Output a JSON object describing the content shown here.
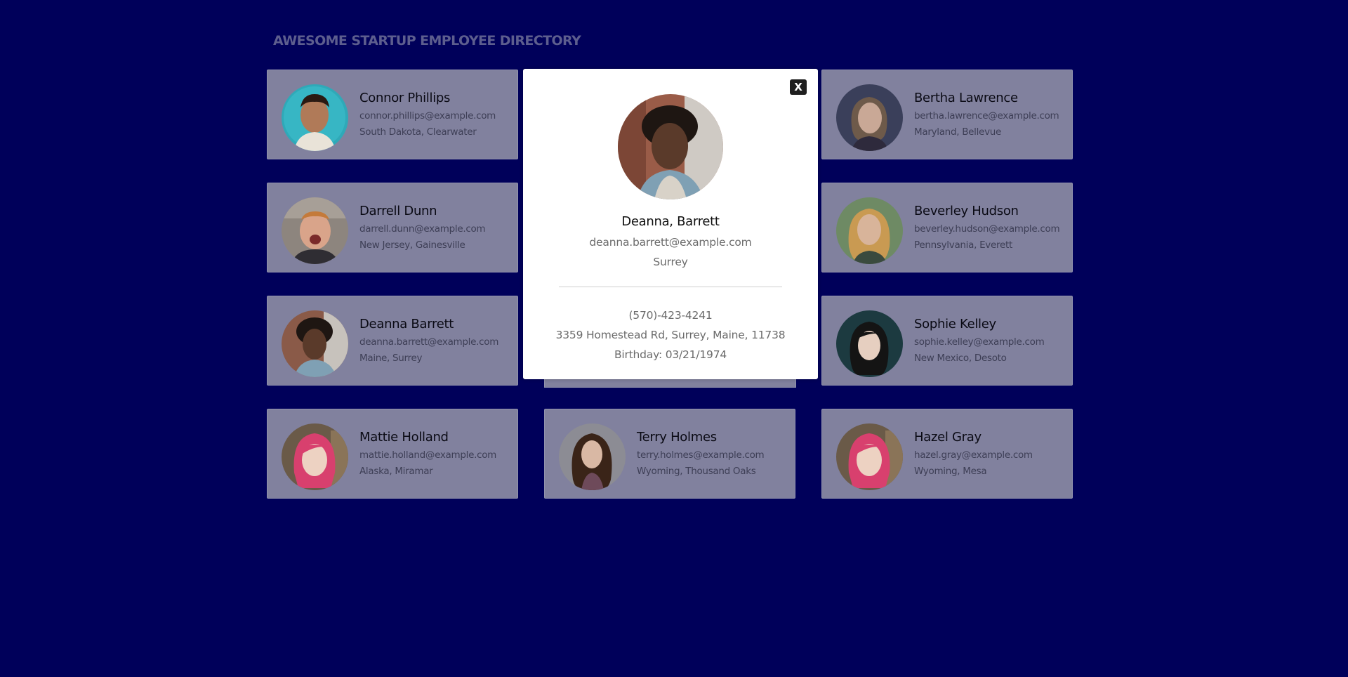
{
  "page": {
    "title": "AWESOME STARTUP EMPLOYEE DIRECTORY"
  },
  "employees": [
    {
      "name": "Connor Phillips",
      "email": "connor.phillips@example.com",
      "location": "South Dakota, Clearwater"
    },
    {
      "name": "Bertha Lawrence",
      "email": "bertha.lawrence@example.com",
      "location": "Maryland, Bellevue"
    },
    {
      "name": "Darrell Dunn",
      "email": "darrell.dunn@example.com",
      "location": "New Jersey, Gainesville"
    },
    {
      "name": "Beverley Hudson",
      "email": "beverley.hudson@example.com",
      "location": "Pennsylvania, Everett"
    },
    {
      "name": "Deanna Barrett",
      "email": "deanna.barrett@example.com",
      "location": "Maine, Surrey"
    },
    {
      "name": "Sophie Kelley",
      "email": "sophie.kelley@example.com",
      "location": "New Mexico, Desoto"
    },
    {
      "name": "Mattie Holland",
      "email": "mattie.holland@example.com",
      "location": "Alaska, Miramar"
    },
    {
      "name": "Terry Holmes",
      "email": "terry.holmes@example.com",
      "location": "Wyoming, Thousand Oaks"
    },
    {
      "name": "Hazel Gray",
      "email": "hazel.gray@example.com",
      "location": "Wyoming, Mesa"
    }
  ],
  "modal": {
    "close_label": "X",
    "name": "Deanna, Barrett",
    "email": "deanna.barrett@example.com",
    "city": "Surrey",
    "phone": "(570)-423-4241",
    "address": "3359 Homestead Rd, Surrey, Maine, 11738",
    "birthday": "Birthday: 03/21/1974"
  },
  "colors": {
    "page_background": "#00005a",
    "card_background_dimmed": "#81819e",
    "modal_background": "#ffffff"
  }
}
